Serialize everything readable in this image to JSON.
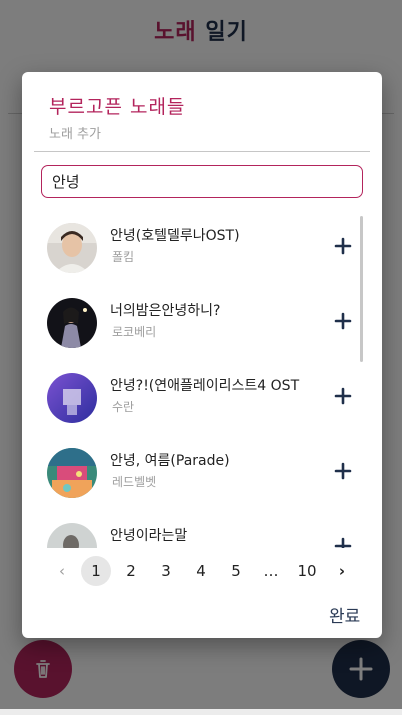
{
  "app": {
    "title_part1": "노래",
    "title_part2": "일기"
  },
  "dialog": {
    "title": "부르고픈 노래들",
    "subtitle": "노래 추가",
    "search_value": "안녕",
    "done_label": "완료"
  },
  "songs": [
    {
      "title": "안녕(호텔델루나OST)",
      "artist": "폴킴"
    },
    {
      "title": "너의밤은안녕하니?",
      "artist": "로코베리"
    },
    {
      "title": "안녕?!(연애플레이리스트4 OST",
      "artist": "수란"
    },
    {
      "title": "안녕, 여름(Parade)",
      "artist": "레드벨벳"
    },
    {
      "title": "안녕이라는말",
      "artist": ""
    }
  ],
  "pagination": {
    "prev": "‹",
    "pages": [
      "1",
      "2",
      "3",
      "4",
      "5"
    ],
    "ellipsis": "…",
    "last": "10",
    "next": "›",
    "active_page": "1"
  },
  "icons": {
    "add": "plus-icon",
    "delete": "trash-icon",
    "fab_add": "plus-icon"
  },
  "colors": {
    "accent": "#b3245c",
    "navy": "#1f2f4a"
  }
}
